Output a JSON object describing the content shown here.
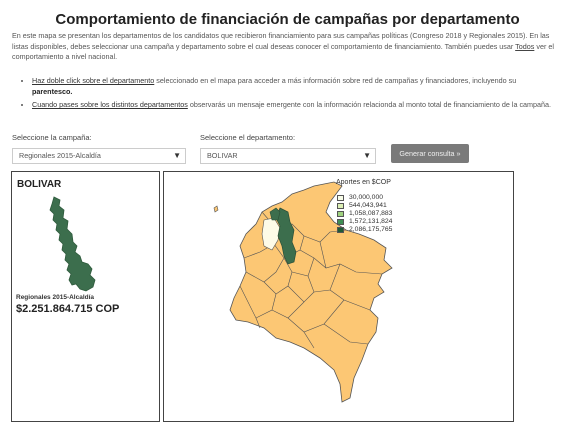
{
  "page": {
    "title": "Comportamiento de financiación de campañas por departamento",
    "intro_1": "En este mapa se presentan los departamentos de los candidatos que recibieron financiamiento para sus campañas políticas (Congreso 2018 y Regionales 2015). En las listas disponibles, debes seleccionar una campaña y departamento sobre el cual deseas conocer el comportamiento de financiamiento. También puedes usar ",
    "intro_link": "Todos",
    "intro_2": " ver el comportamiento a nivel nacional."
  },
  "tips": [
    {
      "link": "Haz doble click sobre el departamento",
      "text": " seleccionado en el mapa para acceder a más información sobre red de campañas y financiadores, incluyendo su ",
      "bold": "parentesco."
    },
    {
      "link": "Cuando pases sobre los distintos departamentos",
      "text": " observarás un mensaje emergente con la información relacionda al monto total de financiamiento de la campaña."
    }
  ],
  "controls": {
    "campaign_label": "Seleccione la campaña:",
    "campaign_value": "Regionales 2015-Alcaldía",
    "department_label": "Seleccione el departamento:",
    "department_value": "BOLIVAR",
    "generate_button": "Generar consulta »",
    "caret": "▼"
  },
  "detail": {
    "department": "BOLIVAR",
    "campaign": "Regionales 2015-Alcaldía",
    "amount": "$2.251.864.715 COP"
  },
  "legend": {
    "title": "Aportes en $COP",
    "items": [
      {
        "label": "30,000,000",
        "color": "#f7fce8"
      },
      {
        "label": "544,043,941",
        "color": "#dcefb5"
      },
      {
        "label": "1,058,087,883",
        "color": "#9fd27f"
      },
      {
        "label": "1,572,131,824",
        "color": "#3f8f55"
      },
      {
        "label": "2,086,175,765",
        "color": "#1f5a35"
      }
    ]
  },
  "colors": {
    "map_fill": "#fcc774",
    "map_stroke": "#555555",
    "selected_fill": "#3c6e4d",
    "unselected_light": "#fdfbe8"
  }
}
